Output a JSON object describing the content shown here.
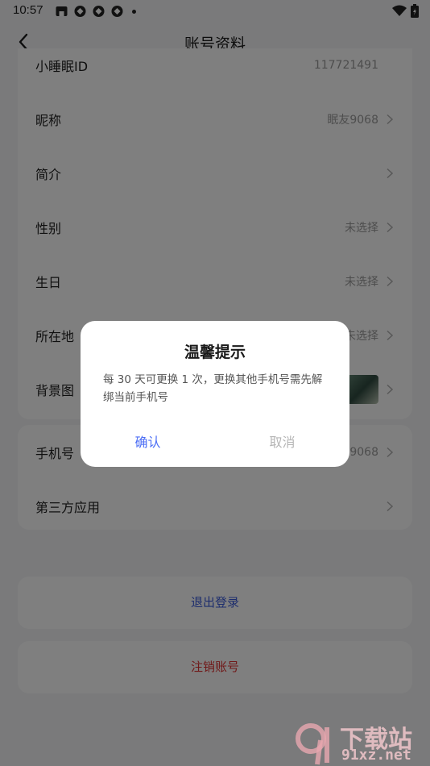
{
  "status_bar": {
    "time": "10:57"
  },
  "nav": {
    "title": "账号资料"
  },
  "profile_rows": [
    {
      "label": "小睡眠ID",
      "value": "117721491"
    },
    {
      "label": "昵称",
      "value": "眠友9068"
    },
    {
      "label": "简介",
      "value": ""
    },
    {
      "label": "性别",
      "value": "未选择"
    },
    {
      "label": "生日",
      "value": "未选择"
    },
    {
      "label": "所在地",
      "value": "未选择"
    },
    {
      "label": "背景图",
      "value": ""
    }
  ],
  "account_rows": [
    {
      "label": "手机号",
      "value": "9068"
    },
    {
      "label": "第三方应用",
      "value": ""
    }
  ],
  "actions": {
    "logout": "退出登录",
    "delete_account": "注销账号"
  },
  "dialog": {
    "title": "温馨提示",
    "message": "每 30 天可更换 1 次，更换其他手机号需先解绑当前手机号",
    "confirm": "确认",
    "cancel": "取消"
  },
  "watermark": {
    "brand": "下载站",
    "url": "91xz.net"
  },
  "colors": {
    "accent": "#4c6ef5",
    "danger": "#e03131",
    "logout": "#3b5bdb"
  }
}
